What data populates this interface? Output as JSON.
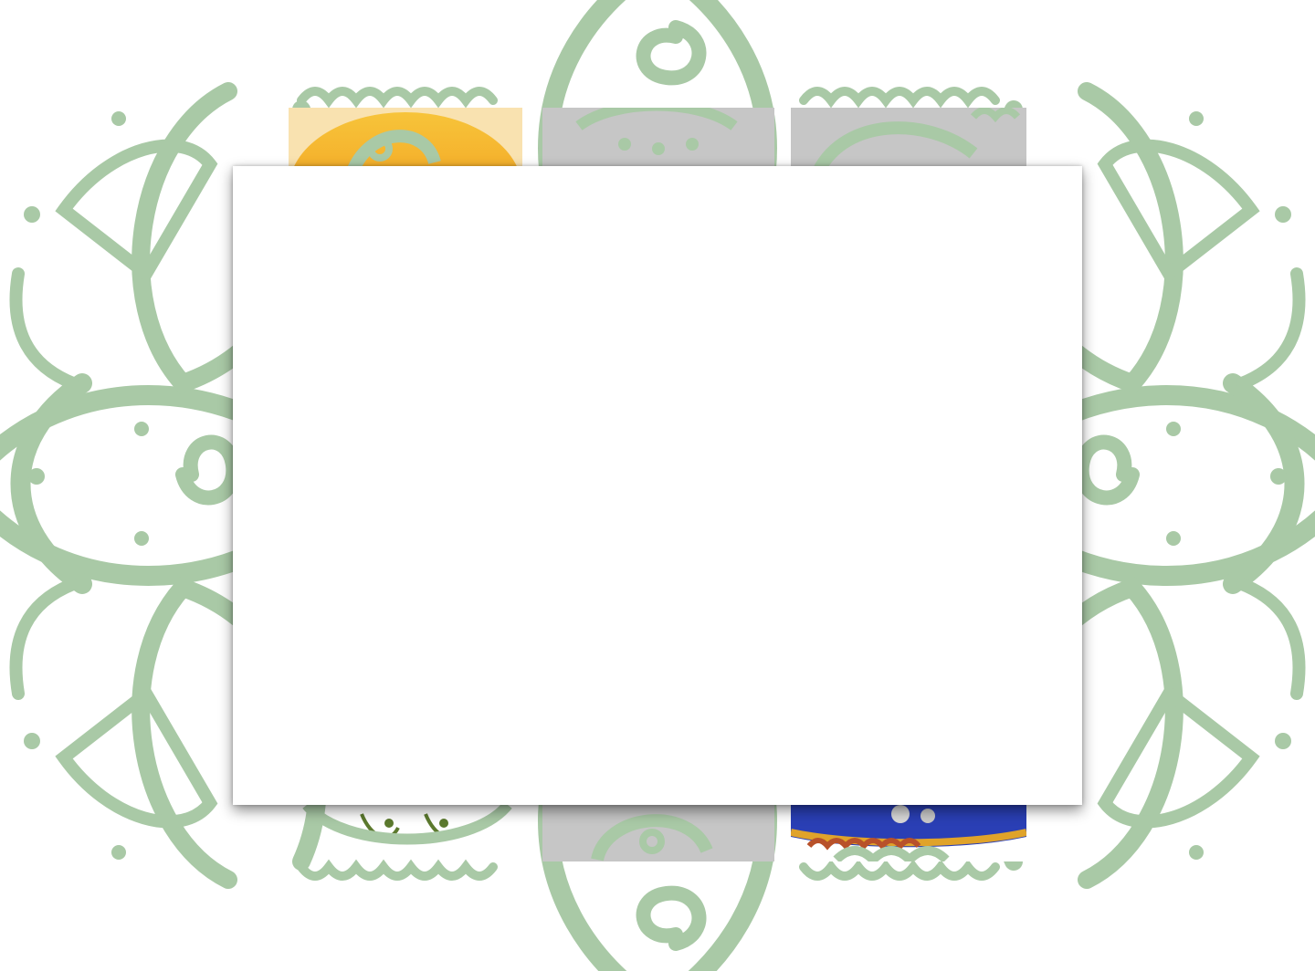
{
  "theme": {
    "ornament_color": "#a9c9a6",
    "modal_background": "#ffffff",
    "placeholder_gray": "#c6c6c6"
  },
  "background": {
    "icon": "mandala-ornament-icon"
  },
  "tiles": [
    {
      "icon": "sun-image-icon",
      "accent": "#f3a51c"
    },
    {
      "icon": "image-placeholder-icon",
      "accent": "#c6c6c6"
    },
    {
      "icon": "image-placeholder-icon",
      "accent": "#c6c6c6"
    },
    {
      "icon": "bird-illustration-icon",
      "accent": "#5c7a2e"
    },
    {
      "icon": "image-placeholder-icon",
      "accent": "#c6c6c6"
    },
    {
      "icon": "embroidered-textile-icon",
      "accent": "#2a3fb5"
    }
  ],
  "modal": {
    "content": ""
  }
}
